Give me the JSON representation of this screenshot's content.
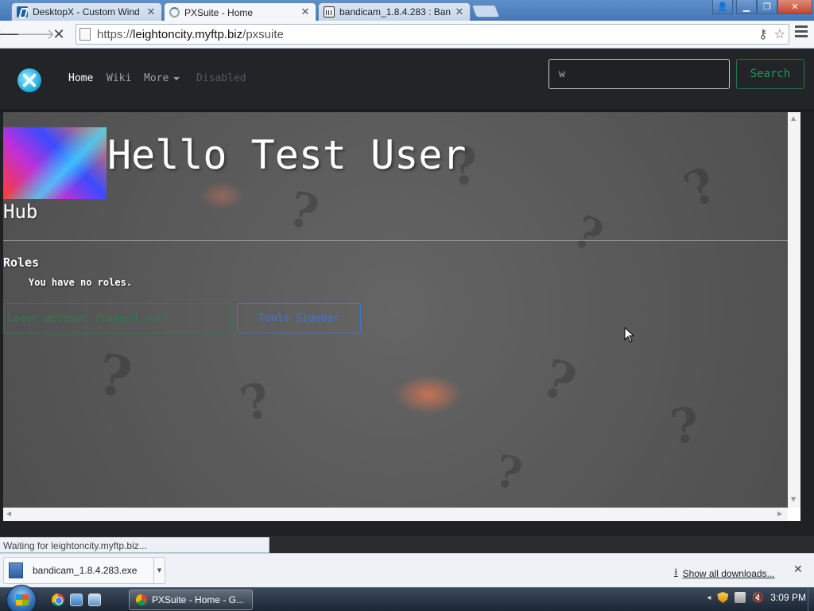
{
  "browser": {
    "tabs": [
      {
        "title": "DesktopX - Custom Wind",
        "icon": "desktopx-favicon-icon",
        "active": false
      },
      {
        "title": "PXSuite - Home",
        "icon": "loading-spinner-icon",
        "active": true
      },
      {
        "title": "bandicam_1.8.4.283 : Ban",
        "icon": "bank-favicon-icon",
        "active": false
      }
    ],
    "url_scheme": "https://",
    "url_host": "leightoncity.myftp.biz",
    "url_path": "/pxsuite",
    "status_text": "Waiting for leightoncity.myftp.biz..."
  },
  "site": {
    "nav": {
      "home": "Home",
      "wiki": "Wiki",
      "more": "More",
      "disabled": "Disabled"
    },
    "search": {
      "value": "w",
      "button": "Search"
    },
    "hero_title": "Hello Test User",
    "hub_heading": "Hub",
    "roles_heading": "Roles",
    "roles_text": "You have no roles.",
    "buttons": {
      "green": "Leave account (Logged out)",
      "blue": "Tools Sidebar"
    },
    "colors": {
      "navbar_bg": "#222427",
      "search_button": "#1e9a5c",
      "green_button": "#2e7a50",
      "blue_button": "#3e78d6"
    }
  },
  "downloads": {
    "item_name": "bandicam_1.8.4.283.exe",
    "show_all": "Show all downloads..."
  },
  "taskbar": {
    "active_window": "PXSuite - Home - G...",
    "clock": "3:09 PM"
  }
}
